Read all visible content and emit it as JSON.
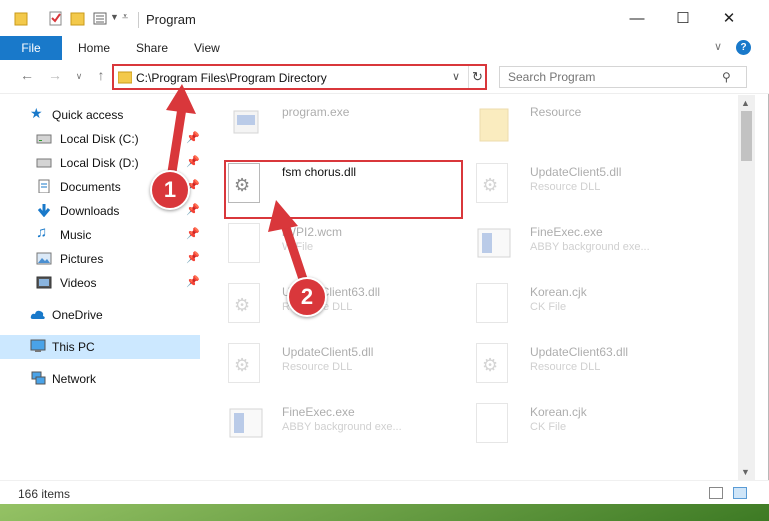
{
  "window": {
    "title": "Program"
  },
  "ribbon": {
    "file_label": "File",
    "tabs": [
      "Home",
      "Share",
      "View"
    ]
  },
  "navbar": {
    "address": "C:\\Program Files\\Program Directory",
    "search_placeholder": "Search Program"
  },
  "sidebar": {
    "items": [
      {
        "label": "Quick access",
        "icon": "star-icon"
      },
      {
        "label": "Local Disk (C:)",
        "icon": "drive-icon",
        "pinned": true
      },
      {
        "label": "Local Disk (D:)",
        "icon": "drive-icon",
        "pinned": true
      },
      {
        "label": "Documents",
        "icon": "documents-icon",
        "pinned": true
      },
      {
        "label": "Downloads",
        "icon": "download-icon",
        "pinned": true
      },
      {
        "label": "Music",
        "icon": "music-icon",
        "pinned": true
      },
      {
        "label": "Pictures",
        "icon": "pictures-icon",
        "pinned": true
      },
      {
        "label": "Videos",
        "icon": "videos-icon",
        "pinned": true
      },
      {
        "label": "OneDrive",
        "icon": "cloud-icon"
      },
      {
        "label": "This PC",
        "icon": "computer-icon",
        "selected": true
      },
      {
        "label": "Network",
        "icon": "network-icon"
      }
    ]
  },
  "files": [
    {
      "name": "program.exe",
      "type": "",
      "icon": "exe-icon"
    },
    {
      "name": "Resource",
      "type": "",
      "icon": "folder-icon"
    },
    {
      "name": "fsm chorus.dll",
      "type": "",
      "icon": "dll-icon",
      "highlighted": true
    },
    {
      "name": "UpdateClient5.dll",
      "type": "Resource DLL",
      "icon": "dll-icon"
    },
    {
      "name": "iWPI2.wcm",
      "type": "W File",
      "icon": "file-icon"
    },
    {
      "name": "FineExec.exe",
      "type": "ABBY background exe...",
      "icon": "app-icon"
    },
    {
      "name": "UpdateClient63.dll",
      "type": "Resource DLL",
      "icon": "dll-icon"
    },
    {
      "name": "Korean.cjk",
      "type": "CK File",
      "icon": "file-icon"
    },
    {
      "name": "UpdateClient5.dll",
      "type": "Resource DLL",
      "icon": "dll-icon"
    },
    {
      "name": "UpdateClient63.dll",
      "type": "Resource DLL",
      "icon": "dll-icon"
    },
    {
      "name": "FineExec.exe",
      "type": "ABBY background exe...",
      "icon": "app-icon"
    },
    {
      "name": "Korean.cjk",
      "type": "CK File",
      "icon": "file-icon"
    }
  ],
  "status": {
    "item_count": "166 items"
  },
  "callouts": [
    "1",
    "2"
  ],
  "colors": {
    "accent": "#1979ca",
    "callout": "#d9373b",
    "selected": "#cce8ff"
  }
}
